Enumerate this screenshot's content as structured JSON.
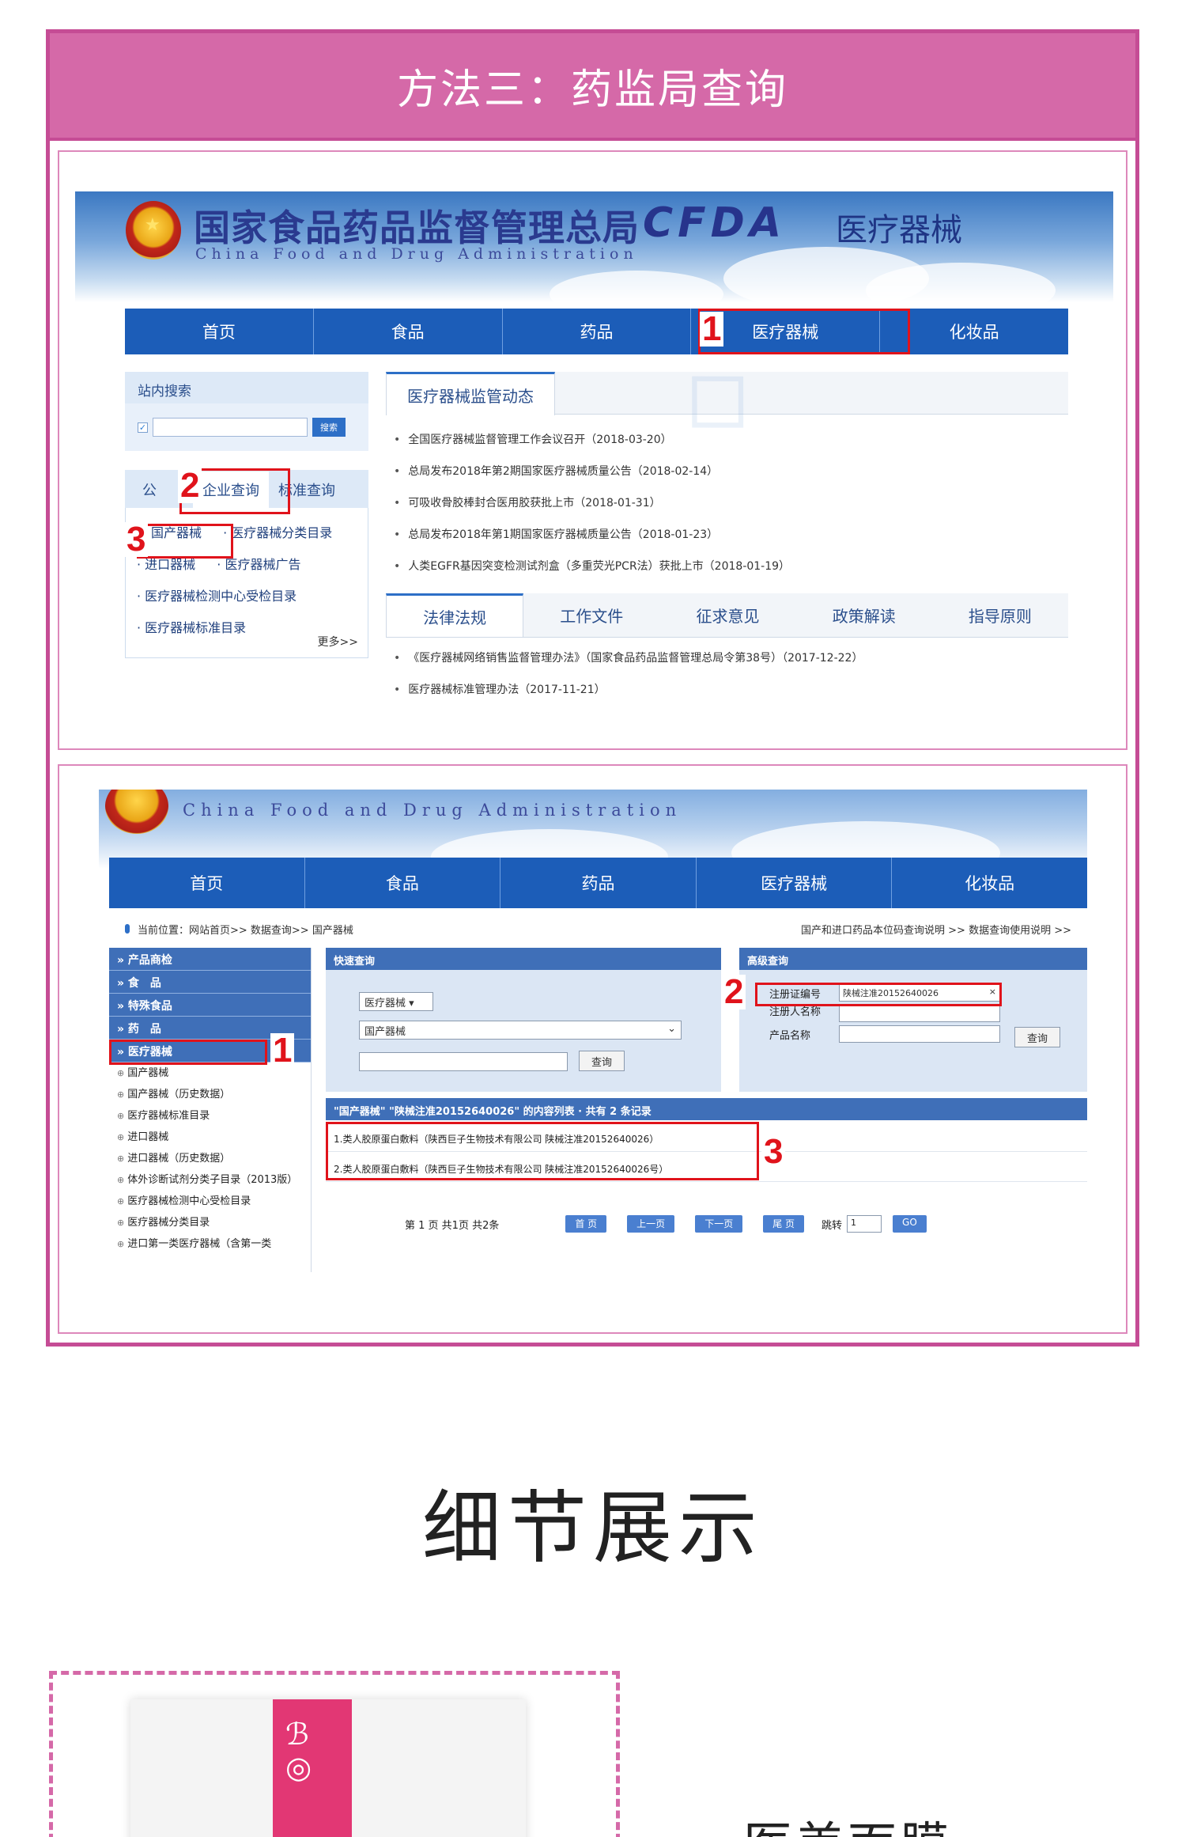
{
  "header": {
    "title": "方法三：药监局查询"
  },
  "shot1": {
    "agency_cn": "国家食品药品监督管理总局",
    "agency_en": "China Food and Drug Administration",
    "brand": "CFDA",
    "section": "医疗器械",
    "nav": [
      "首页",
      "食品",
      "药品",
      "医疗器械",
      "化妆品"
    ],
    "site_search_label": "站内搜索",
    "search_button": "搜索",
    "sidebar_tabs": [
      "公",
      "企业查询",
      "标准查询"
    ],
    "sidebar_links": [
      "国产器械",
      "· 医疗器械分类目录",
      "· 进口器械",
      "· 医疗器械广告",
      "· 医疗器械检测中心受检目录",
      "· 医疗器械标准目录"
    ],
    "more": "更多>>",
    "news_tab": "医疗器械监管动态",
    "news": [
      "全国医疗器械监督管理工作会议召开（2018-03-20）",
      "总局发布2018年第2期国家医疗器械质量公告（2018-02-14）",
      "可吸收骨胶棒封合医用胶获批上市（2018-01-31）",
      "总局发布2018年第1期国家医疗器械质量公告（2018-01-23）",
      "人类EGFR基因突变检测试剂盒（多重荧光PCR法）获批上市（2018-01-19）"
    ],
    "law_tabs": [
      "法律法规",
      "工作文件",
      "征求意见",
      "政策解读",
      "指导原则"
    ],
    "laws": [
      "《医疗器械网络销售监督管理办法》（国家食品药品监督管理总局令第38号）（2017-12-22）",
      "医疗器械标准管理办法（2017-11-21）"
    ],
    "markers": [
      "1",
      "2",
      "3"
    ]
  },
  "shot2": {
    "agency_en": "China Food and Drug Administration",
    "nav": [
      "首页",
      "食品",
      "药品",
      "医疗器械",
      "化妆品"
    ],
    "breadcrumb": "当前位置：网站首页>> 数据查询>> 国产器械",
    "breadcrumb_right": "国产和进口药品本位码查询说明 >>    数据查询使用说明 >>",
    "menu_cats": [
      "» 产品商检",
      "» 食　品",
      "» 特殊食品",
      "» 药　品",
      "» 医疗器械"
    ],
    "menu_subs": [
      "国产器械",
      "国产器械（历史数据）",
      "医疗器械标准目录",
      "进口器械",
      "进口器械（历史数据）",
      "体外诊断试剂分类子目录（2013版）",
      "医疗器械检测中心受检目录",
      "医疗器械分类目录",
      "进口第一类医疗器械（含第一类"
    ],
    "quick_title": "快速查询",
    "quick_select1": "医疗器械",
    "quick_select2": "国产器械",
    "query_button": "查询",
    "adv_title": "高级查询",
    "adv_fields": [
      "注册证编号",
      "注册人名称",
      "产品名称"
    ],
    "adv_value": "陕械注准20152640026",
    "result_header": "\"国产器械\" \"陕械注准20152640026\" 的内容列表 · 共有 2 条记录",
    "results": [
      "1.类人胶原蛋白敷料（陕西巨子生物技术有限公司 陕械注准20152640026）",
      "2.类人胶原蛋白敷料（陕西巨子生物技术有限公司 陕械注准20152640026号）"
    ],
    "pager_text": "第 1 页 共1页 共2条",
    "pager_buttons": [
      "首 页",
      "上一页",
      "下一页",
      "尾 页"
    ],
    "jump_label": "跳转",
    "jump_value": "1",
    "go": "GO",
    "markers": [
      "1",
      "2",
      "3"
    ]
  },
  "detail": {
    "title": "细节展示",
    "product_text": "医美面膜"
  },
  "colors": {
    "pink": "#d569a8",
    "frame": "#c54c95",
    "nav_blue": "#1c5db8",
    "marker_red": "#e0131b"
  }
}
